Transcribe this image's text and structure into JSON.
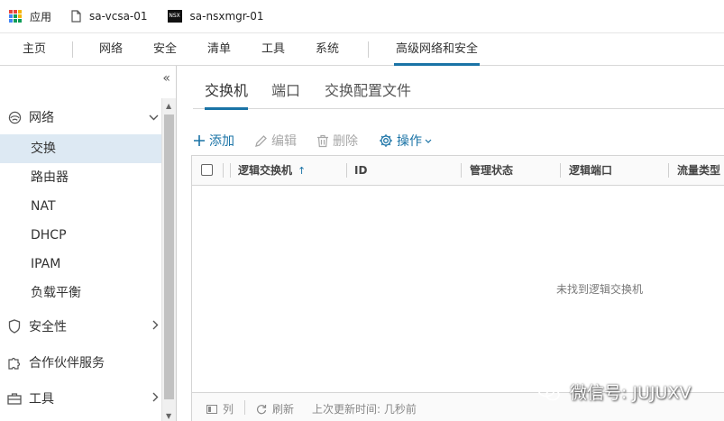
{
  "bookmarks": [
    {
      "label": "应用",
      "icon": "apps-grid-icon"
    },
    {
      "label": "sa-vcsa-01",
      "icon": "page-icon"
    },
    {
      "label": "sa-nsxmgr-01",
      "icon": "nsx-icon",
      "icon_text": "NSX"
    }
  ],
  "topnav": {
    "items": [
      "主页",
      "网络",
      "安全",
      "清单",
      "工具",
      "系统",
      "高级网络和安全"
    ],
    "active": "高级网络和安全"
  },
  "sidebar": {
    "collapse_glyph": "«",
    "sections": {
      "network": {
        "label": "网络",
        "expanded": true
      },
      "security": {
        "label": "安全性"
      },
      "partner": {
        "label": "合作伙伴服务"
      },
      "tools": {
        "label": "工具"
      }
    },
    "network_items": [
      "交换",
      "路由器",
      "NAT",
      "DHCP",
      "IPAM",
      "负载平衡"
    ],
    "selected": "交换"
  },
  "tabs": [
    "交换机",
    "端口",
    "交换配置文件"
  ],
  "active_tab": "交换机",
  "toolbar": {
    "add": "添加",
    "edit": "编辑",
    "delete": "删除",
    "actions": "操作"
  },
  "grid": {
    "columns": [
      "逻辑交换机",
      "ID",
      "管理状态",
      "逻辑端口",
      "流量类型"
    ],
    "sort_glyph": "↑",
    "empty_message": "未找到逻辑交换机",
    "footer": {
      "columns": "列",
      "refresh": "刷新",
      "last_update": "上次更新时间: 几秒前"
    }
  },
  "watermark": "微信号: JUJUXV",
  "colors": {
    "accent": "#1a73a6",
    "selected_bg": "#dde9f3"
  }
}
